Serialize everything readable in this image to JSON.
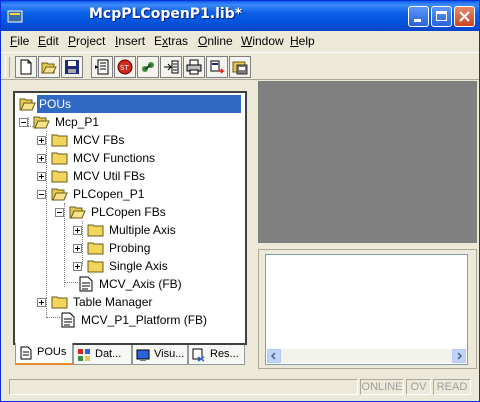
{
  "window": {
    "title": "McpPLCopenP1.lib*"
  },
  "menu": [
    {
      "pre": "",
      "u": "F",
      "post": "ile"
    },
    {
      "pre": "",
      "u": "E",
      "post": "dit"
    },
    {
      "pre": "",
      "u": "P",
      "post": "roject"
    },
    {
      "pre": "",
      "u": "I",
      "post": "nsert"
    },
    {
      "pre": "E",
      "u": "x",
      "post": "tras"
    },
    {
      "pre": "",
      "u": "O",
      "post": "nline"
    },
    {
      "pre": "",
      "u": "W",
      "post": "indow"
    },
    {
      "pre": "",
      "u": "H",
      "post": "elp"
    }
  ],
  "toolbar": [
    "new-icon",
    "open-icon",
    "save-icon",
    "compile-icon",
    "stop-icon",
    "login-icon",
    "logout-icon",
    "print-icon",
    "step-icon",
    "project-icon"
  ],
  "tree": {
    "root": "POUs",
    "mcp_p1": "Mcp_P1",
    "mcv_fbs": "MCV FBs",
    "mcv_functions": "MCV Functions",
    "mcv_util_fbs": "MCV Util FBs",
    "plcopen_p1": "PLCopen_P1",
    "plcopen_fbs": "PLCopen FBs",
    "multiple_axis": "Multiple Axis",
    "probing": "Probing",
    "single_axis": "Single Axis",
    "mcv_axis": "MCV_Axis (FB)",
    "table_manager": "Table Manager",
    "mcv_p1_platform": "MCV_P1_Platform (FB)"
  },
  "tabs": {
    "pous": "POUs",
    "data": "Dat...",
    "visu": "Visu...",
    "res": "Res..."
  },
  "status": {
    "online": "ONLINE",
    "ov": "OV",
    "read": "READ"
  }
}
